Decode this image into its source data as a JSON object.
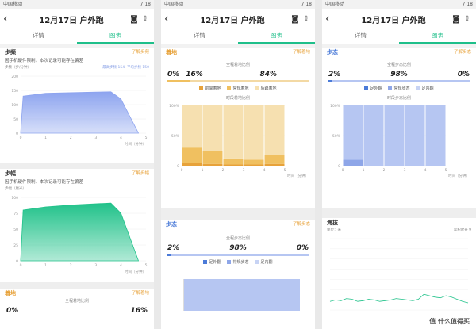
{
  "status": {
    "left": "中国移动",
    "time": "7:18"
  },
  "screens": [
    {
      "title": "12月17日 户外跑",
      "tabs": [
        "详情",
        "图表"
      ],
      "step_freq": {
        "title": "步频",
        "link": "了解步频",
        "note": "因手机硬件限制，本次记录可能存在偏差",
        "unit_label": "步频（步/分钟）",
        "legend": [
          "最高步频 154",
          "平均步频 150"
        ],
        "chart_data": {
          "type": "area",
          "x": [
            0,
            0.1,
            1,
            2,
            3,
            3.6,
            4,
            4.7
          ],
          "values": [
            0,
            130,
            140,
            142,
            144,
            145,
            120,
            0
          ],
          "ylim": [
            0,
            200
          ],
          "yticks": [
            0,
            50,
            100,
            150,
            200
          ],
          "xticks": [
            0,
            1,
            2,
            3,
            4,
            5
          ],
          "xlabel": "时间（分钟）",
          "color": "#8da4ef"
        }
      },
      "stride": {
        "title": "步幅",
        "link": "了解步幅",
        "note": "因手机硬件限制，本次记录可能存在偏差",
        "unit_label": "步幅（厘米）",
        "chart_data": {
          "type": "area",
          "x": [
            0,
            0.1,
            1,
            2,
            3,
            3.6,
            4,
            4.7
          ],
          "values": [
            0,
            80,
            85,
            88,
            90,
            91,
            75,
            0
          ],
          "ylim": [
            0,
            100
          ],
          "yticks": [
            0,
            25,
            50,
            75,
            100
          ],
          "xticks": [
            0,
            1,
            2,
            3,
            4,
            5
          ],
          "xlabel": "时间（分钟）",
          "color": "#21c28a"
        }
      },
      "landing": {
        "title": "着地",
        "link": "了解着地",
        "sub": "全程着地比例",
        "pcts": [
          "0%",
          "16%"
        ]
      }
    },
    {
      "title": "12月17日 户外跑",
      "tabs": [
        "详情",
        "图表"
      ],
      "landing": {
        "title": "着地",
        "link": "了解着地",
        "sub": "全程着地比例",
        "pcts": [
          "0%",
          "16%",
          "84%"
        ],
        "legend": [
          {
            "label": "前掌着地",
            "color": "#e7a23a"
          },
          {
            "label": "常规着地",
            "color": "#f0c060"
          },
          {
            "label": "后跟着地",
            "color": "#f6e0b0"
          }
        ],
        "period": "时段着地比例",
        "chart_data": {
          "type": "bar",
          "categories": [
            0,
            1,
            2,
            3,
            4
          ],
          "series": [
            {
              "name": "前掌着地",
              "values": [
                5,
                3,
                2,
                2,
                3
              ]
            },
            {
              "name": "常规着地",
              "values": [
                25,
                22,
                10,
                8,
                15
              ]
            },
            {
              "name": "后跟着地",
              "values": [
                70,
                75,
                88,
                90,
                82
              ]
            }
          ],
          "ylim": [
            0,
            100
          ],
          "yticks": [
            "100%",
            "50%",
            "0"
          ],
          "xticks": [
            0,
            1,
            2,
            3,
            4,
            5
          ],
          "xlabel": "时间（分钟）"
        }
      },
      "gait": {
        "title": "步态",
        "link": "了解步态",
        "sub": "全程步态比例",
        "pcts": [
          "2%",
          "98%",
          "0%"
        ],
        "legend": [
          {
            "label": "足外翻",
            "color": "#4b7bd8"
          },
          {
            "label": "常规步态",
            "color": "#8ea6e8"
          },
          {
            "label": "足内翻",
            "color": "#c7d3f4"
          }
        ]
      }
    },
    {
      "title": "12月17日 户外跑",
      "tabs": [
        "详情",
        "图表"
      ],
      "gait": {
        "title": "步态",
        "link": "了解步态",
        "sub": "全程步态比例",
        "pcts": [
          "2%",
          "98%",
          "0%"
        ],
        "legend": [
          {
            "label": "足外翻",
            "color": "#4b7bd8"
          },
          {
            "label": "常规步态",
            "color": "#8ea6e8"
          },
          {
            "label": "足内翻",
            "color": "#c7d3f4"
          }
        ],
        "period": "时段步态比例",
        "chart_data": {
          "type": "bar",
          "categories": [
            0,
            1,
            2,
            3,
            4
          ],
          "series": [
            {
              "name": "足外翻",
              "values": [
                10,
                0,
                0,
                0,
                0
              ]
            },
            {
              "name": "常规步态",
              "values": [
                90,
                100,
                100,
                100,
                100
              ]
            }
          ],
          "ylim": [
            0,
            100
          ],
          "yticks": [
            "100%",
            "50%",
            "0"
          ],
          "xticks": [
            0,
            1,
            2,
            3,
            4,
            5
          ],
          "xlabel": "时间（分钟）"
        }
      },
      "altitude": {
        "title": "海拔",
        "unit": "单位：米",
        "cum": "累积爬升 9",
        "chart_data": {
          "type": "line",
          "ylim": [
            0,
            1
          ],
          "values": [
            0.12,
            0.14,
            0.13,
            0.16,
            0.15,
            0.12,
            0.13,
            0.15,
            0.14,
            0.12,
            0.13,
            0.14,
            0.16,
            0.15,
            0.14,
            0.13,
            0.15,
            0.22,
            0.2,
            0.18,
            0.17,
            0.2,
            0.18,
            0.15,
            0.12,
            0.1
          ]
        }
      }
    }
  ],
  "watermark": "值 什么值得买"
}
